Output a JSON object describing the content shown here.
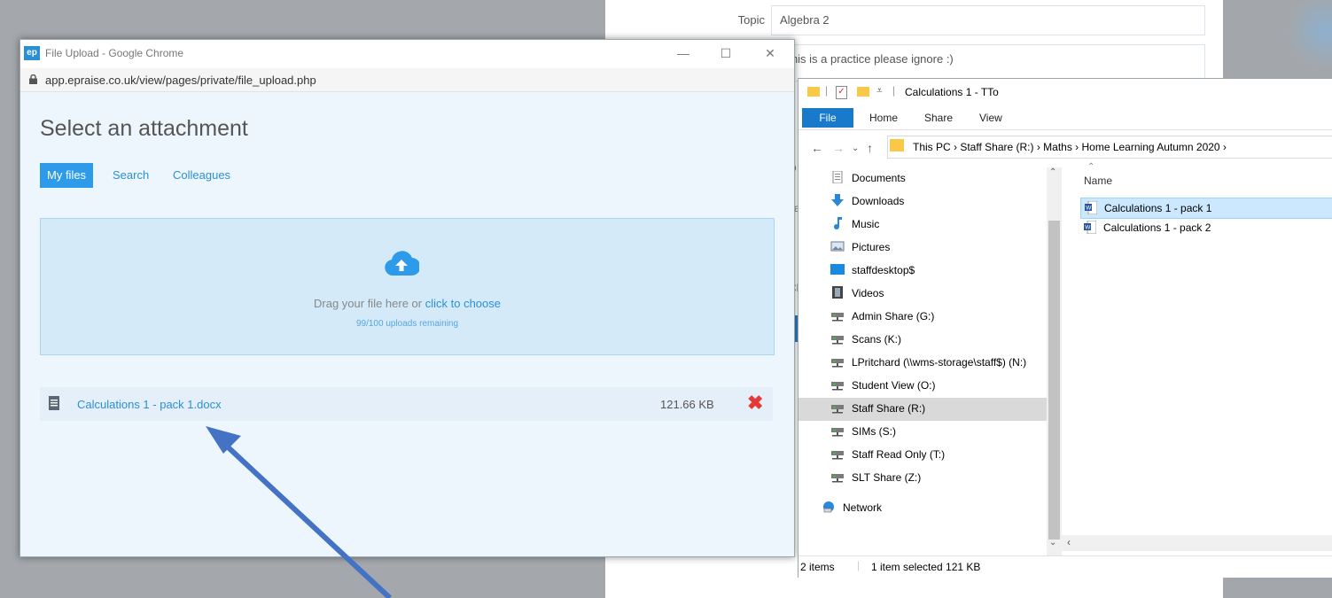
{
  "background": {
    "topic_label": "Topic",
    "topic_value": "Algebra 2",
    "description": "This is a practice please ignore :)",
    "peek_letters": [
      "D",
      "va",
      "c",
      "Ch",
      "ic"
    ]
  },
  "chrome": {
    "logo": "ep",
    "title": "File Upload - Google Chrome",
    "url": "app.epraise.co.uk/view/pages/private/file_upload.php",
    "minimize": "—",
    "maximize": "☐",
    "close": "✕"
  },
  "upload": {
    "heading": "Select an attachment",
    "tabs": [
      {
        "label": "My files",
        "active": true
      },
      {
        "label": "Search",
        "active": false
      },
      {
        "label": "Colleagues",
        "active": false
      }
    ],
    "drag_text": "Drag your file here or ",
    "drag_link": "click to choose",
    "remaining": "99/100 uploads remaining",
    "file": {
      "name": "Calculations 1 - pack 1.docx",
      "size": "121.66 KB"
    }
  },
  "explorer": {
    "title": "Calculations 1 - TTo",
    "ribbon": {
      "file": "File",
      "home": "Home",
      "share": "Share",
      "view": "View"
    },
    "address": "This PC  ›  Staff Share (R:)  ›  Maths  ›  Home Learning Autumn 2020  ›",
    "nav_items": [
      {
        "label": "Documents",
        "icon": "document-icon"
      },
      {
        "label": "Downloads",
        "icon": "download-icon"
      },
      {
        "label": "Music",
        "icon": "music-icon"
      },
      {
        "label": "Pictures",
        "icon": "picture-icon"
      },
      {
        "label": "staffdesktop$",
        "icon": "desktop-icon"
      },
      {
        "label": "Videos",
        "icon": "video-icon"
      },
      {
        "label": "Admin Share (G:)",
        "icon": "network-drive-icon"
      },
      {
        "label": "Scans (K:)",
        "icon": "network-drive-icon"
      },
      {
        "label": "LPritchard (\\\\wms-storage\\staff$) (N:)",
        "icon": "network-drive-icon"
      },
      {
        "label": "Student View (O:)",
        "icon": "network-drive-icon"
      },
      {
        "label": "Staff Share (R:)",
        "icon": "network-drive-icon"
      },
      {
        "label": "SIMs (S:)",
        "icon": "network-drive-icon"
      },
      {
        "label": "Staff Read Only (T:)",
        "icon": "network-drive-icon"
      },
      {
        "label": "SLT Share (Z:)",
        "icon": "network-drive-icon"
      }
    ],
    "network": "Network",
    "column_name": "Name",
    "files": [
      "Calculations 1 - pack 1",
      "Calculations 1 - pack 2"
    ],
    "status_items": "2 items",
    "status_selected": "1 item selected  121 KB"
  },
  "colors": {
    "accent": "#2e9bea",
    "remove": "#e53935",
    "arrow": "#4472c4"
  }
}
